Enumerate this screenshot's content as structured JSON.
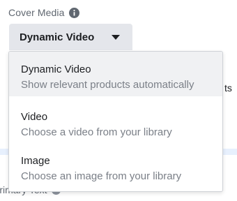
{
  "section": {
    "label": "Cover Media",
    "info_icon": "info-circle-icon"
  },
  "dropdown": {
    "selected_label": "Dynamic Video",
    "caret_icon": "caret-down-icon",
    "options": [
      {
        "title": "Dynamic Video",
        "description": "Show relevant products automatically",
        "selected": true
      },
      {
        "title": "Video",
        "description": "Choose a video from your library",
        "selected": false
      },
      {
        "title": "Image",
        "description": "Choose an image from your library",
        "selected": false
      }
    ]
  },
  "background": {
    "truncated_text": "ts",
    "next_section_label": "Primary Text"
  },
  "colors": {
    "button_bg": "#e4e6eb",
    "selected_row_bg": "#f0f1f3",
    "label_gray": "#606770",
    "text_dark": "#1c1e21"
  }
}
